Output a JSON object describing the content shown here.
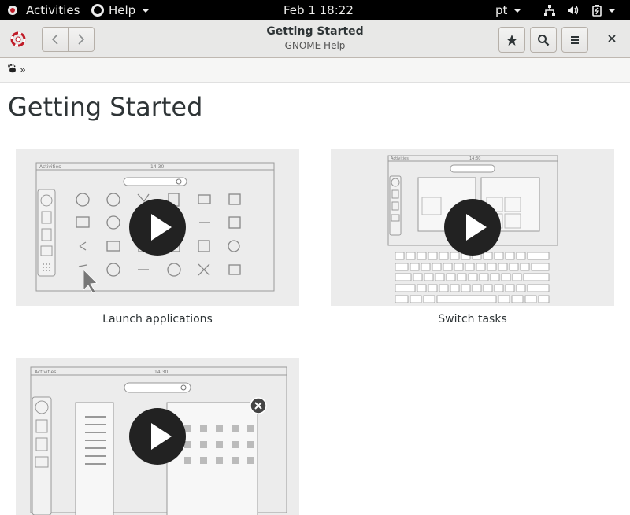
{
  "topbar": {
    "activities": "Activities",
    "help_menu": "Help",
    "clock": "Feb 1  18:22",
    "language": "pt"
  },
  "header": {
    "title": "Getting Started",
    "subtitle": "GNOME Help"
  },
  "breadcrumb": {
    "separator": "»"
  },
  "page": {
    "title": "Getting Started"
  },
  "cards": [
    {
      "caption": "Launch applications",
      "mock_bar_label": "Activities",
      "mock_time": "14:30"
    },
    {
      "caption": "Switch tasks",
      "mock_bar_label": "Activities",
      "mock_time": "14:30"
    },
    {
      "caption": "",
      "mock_bar_label": "Activities",
      "mock_time": "14:30"
    }
  ],
  "icons": [
    "gnome-foot-icon",
    "lifebuoy-icon",
    "back-icon",
    "forward-icon",
    "star-icon",
    "search-icon",
    "menu-icon",
    "close-icon",
    "network-icon",
    "volume-icon",
    "battery-icon"
  ]
}
